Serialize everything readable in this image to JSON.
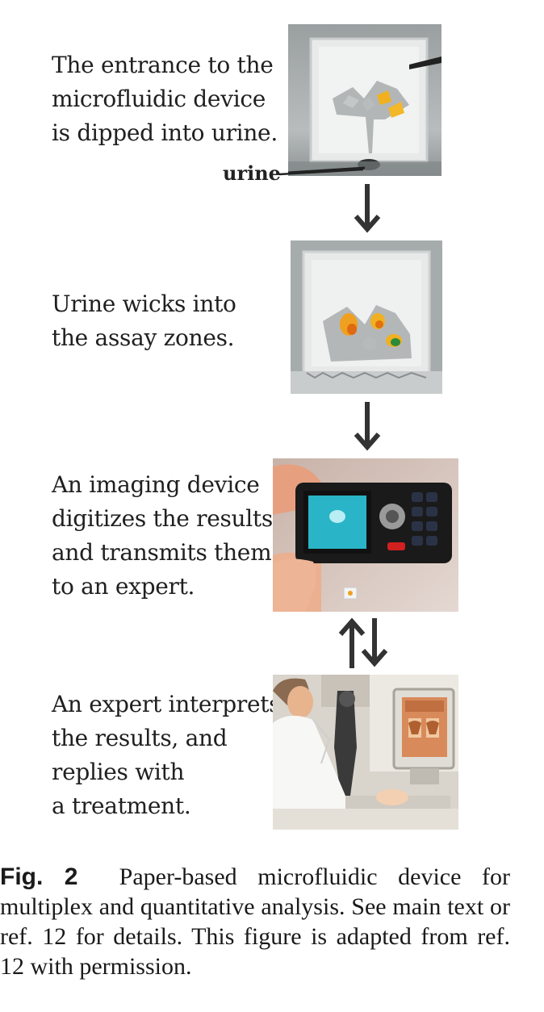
{
  "steps": [
    {
      "lines": [
        "The entrance to the",
        "microfluidic device",
        "is dipped into urine."
      ]
    },
    {
      "lines": [
        "Urine wicks into",
        "the assay zones."
      ]
    },
    {
      "lines": [
        "An imaging device",
        "digitizes the results",
        "and transmits them",
        "to an expert."
      ]
    },
    {
      "lines": [
        "An expert interprets",
        "the results, and",
        "replies with",
        "a treatment."
      ]
    }
  ],
  "urine_label": "urine",
  "caption": {
    "label": "Fig. 2",
    "text": "Paper-based microfluidic device for multiplex and quantitative analysis. See main text or ref. 12 for details. This figure is adapted from ref. 12 with permission."
  },
  "colors": {
    "arrow": "#333333",
    "assay_orange": "#f0a020",
    "assay_green": "#2a8a3a",
    "phone_screen": "#2ab4c8"
  }
}
